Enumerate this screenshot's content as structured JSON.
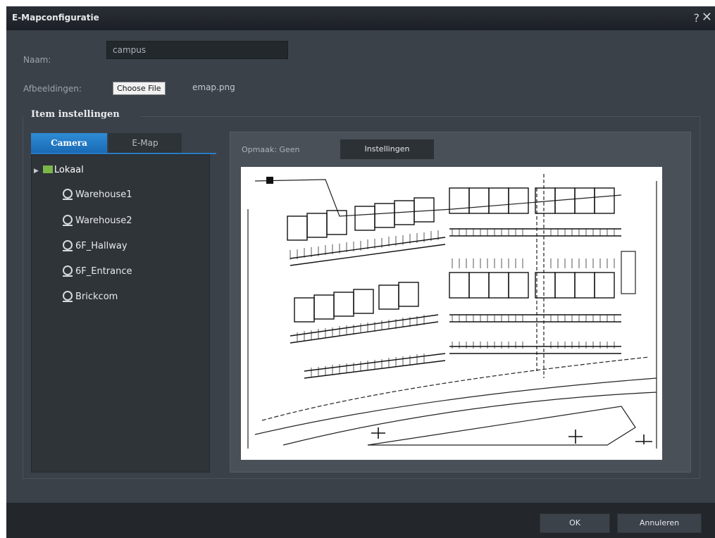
{
  "window": {
    "title": "E-Mapconfiguratie",
    "help": "?",
    "close": "✕"
  },
  "form": {
    "name_label": "Naam:",
    "name_value": "campus",
    "image_label": "Afbeeldingen:",
    "choose_file_label": "Choose File",
    "file_name": "emap.png"
  },
  "section": {
    "title": "Item instellingen"
  },
  "tabs": [
    {
      "label": "Camera",
      "active": true
    },
    {
      "label": "E-Map",
      "active": false
    }
  ],
  "tree": {
    "root": "Lokaal",
    "items": [
      "Warehouse1",
      "Warehouse2",
      "6F_Hallway",
      "6F_Entrance",
      "Brickcom"
    ]
  },
  "map_panel": {
    "layout_label": "Opmaak: Geen",
    "settings_button": "Instellingen"
  },
  "footer": {
    "ok": "OK",
    "cancel": "Annuleren"
  },
  "colors": {
    "accent": "#2a7cc4",
    "background": "#3b4149",
    "footer": "#23272c"
  }
}
